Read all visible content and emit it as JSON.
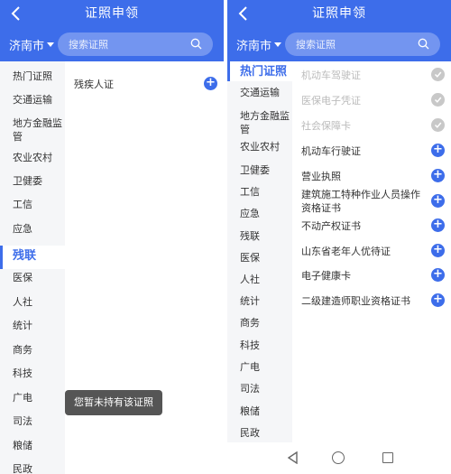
{
  "left_panel": {
    "header": {
      "title": "证照申领",
      "city": "济南市",
      "search_placeholder": "搜索证照"
    },
    "sidebar": [
      {
        "label": "热门证照",
        "active": false
      },
      {
        "label": "交通运输",
        "active": false
      },
      {
        "label": "地方金融监管",
        "active": false
      },
      {
        "label": "农业农村",
        "active": false
      },
      {
        "label": "卫健委",
        "active": false
      },
      {
        "label": "工信",
        "active": false
      },
      {
        "label": "应急",
        "active": false
      },
      {
        "label": "残联",
        "active": true
      },
      {
        "label": "医保",
        "active": false
      },
      {
        "label": "人社",
        "active": false
      },
      {
        "label": "统计",
        "active": false
      },
      {
        "label": "商务",
        "active": false
      },
      {
        "label": "科技",
        "active": false
      },
      {
        "label": "广电",
        "active": false
      },
      {
        "label": "司法",
        "active": false
      },
      {
        "label": "粮储",
        "active": false
      },
      {
        "label": "民政",
        "active": false
      }
    ],
    "items": [
      {
        "label": "残疾人证",
        "status": "add"
      }
    ],
    "toast": "您暂未持有该证照"
  },
  "right_panel": {
    "header": {
      "title": "证照申领",
      "city": "济南市",
      "search_placeholder": "搜索证照"
    },
    "sidebar": [
      {
        "label": "热门证照",
        "active": true
      },
      {
        "label": "交通运输",
        "active": false
      },
      {
        "label": "地方金融监管",
        "active": false
      },
      {
        "label": "农业农村",
        "active": false
      },
      {
        "label": "卫健委",
        "active": false
      },
      {
        "label": "工信",
        "active": false
      },
      {
        "label": "应急",
        "active": false
      },
      {
        "label": "残联",
        "active": false
      },
      {
        "label": "医保",
        "active": false
      },
      {
        "label": "人社",
        "active": false
      },
      {
        "label": "统计",
        "active": false
      },
      {
        "label": "商务",
        "active": false
      },
      {
        "label": "科技",
        "active": false
      },
      {
        "label": "广电",
        "active": false
      },
      {
        "label": "司法",
        "active": false
      },
      {
        "label": "粮储",
        "active": false
      },
      {
        "label": "民政",
        "active": false
      }
    ],
    "items": [
      {
        "label": "机动车驾驶证",
        "status": "added"
      },
      {
        "label": "医保电子凭证",
        "status": "added"
      },
      {
        "label": "社会保障卡",
        "status": "added"
      },
      {
        "label": "机动车行驶证",
        "status": "add"
      },
      {
        "label": "营业执照",
        "status": "add"
      },
      {
        "label": "建筑施工特种作业人员操作资格证书",
        "status": "add"
      },
      {
        "label": "不动产权证书",
        "status": "add"
      },
      {
        "label": "山东省老年人优待证",
        "status": "add"
      },
      {
        "label": "电子健康卡",
        "status": "add"
      },
      {
        "label": "二级建造师职业资格证书",
        "status": "add"
      }
    ]
  },
  "colors": {
    "primary": "#3d6dea",
    "sidebar_bg": "#f5f6f8",
    "toast_bg": "#555555",
    "added_gray": "#c8c8c8"
  }
}
